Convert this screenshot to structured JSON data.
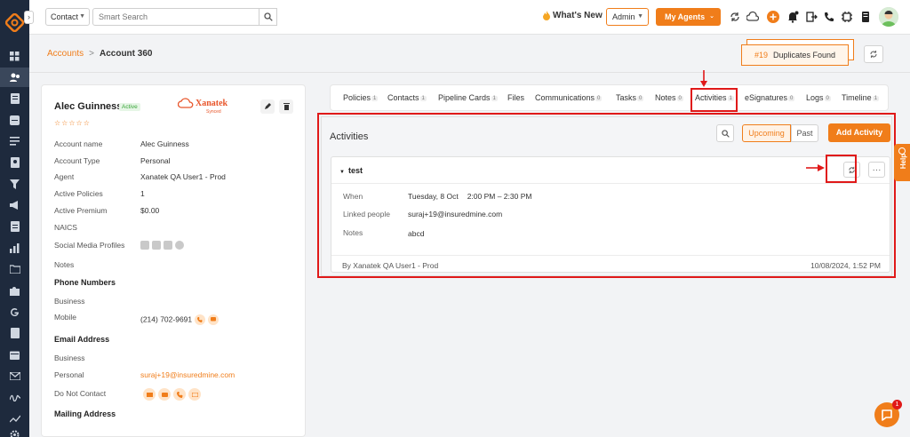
{
  "topbar": {
    "contact_select": "Contact",
    "search_placeholder": "Smart Search",
    "whats_new": "What's New",
    "admin_select": "Admin",
    "my_agents": "My Agents"
  },
  "breadcrumb": {
    "accounts": "Accounts",
    "separator": ">",
    "current": "Account 360"
  },
  "duplicates": {
    "count": "#19",
    "label": "Duplicates Found"
  },
  "account": {
    "name": "Alec Guinness",
    "status": "Active",
    "rating": "☆☆☆☆☆",
    "logo_text": "Xanatek",
    "logo_sub": "Synced",
    "fields": [
      {
        "label": "Account name",
        "value": "Alec Guinness"
      },
      {
        "label": "Account Type",
        "value": "Personal"
      },
      {
        "label": "Agent",
        "value": "Xanatek QA User1 - Prod"
      },
      {
        "label": "Active Policies",
        "value": "1"
      },
      {
        "label": "Active Premium",
        "value": "$0.00"
      },
      {
        "label": "NAICS",
        "value": ""
      },
      {
        "label": "Social Media Profiles",
        "value": ""
      },
      {
        "label": "Notes",
        "value": ""
      }
    ],
    "phone_section": "Phone Numbers",
    "phone_business": "Business",
    "phone_mobile": "Mobile",
    "phone_mobile_value": "(214) 702-9691",
    "email_section": "Email Address",
    "email_business": "Business",
    "email_personal": "Personal",
    "email_personal_value": "suraj+19@insuredmine.com",
    "do_not_contact": "Do Not Contact",
    "mailing_section": "Mailing Address"
  },
  "tabs": [
    {
      "label": "Policies",
      "count": "1"
    },
    {
      "label": "Contacts",
      "count": "1"
    },
    {
      "label": "Pipeline Cards",
      "count": "1"
    },
    {
      "label": "Files",
      "count": ""
    },
    {
      "label": "Communications",
      "count": "0"
    },
    {
      "label": "Tasks",
      "count": "0"
    },
    {
      "label": "Notes",
      "count": "0"
    },
    {
      "label": "Activities",
      "count": "1"
    },
    {
      "label": "eSignatures",
      "count": "0"
    },
    {
      "label": "Logs",
      "count": "0"
    },
    {
      "label": "Timeline",
      "count": "1"
    }
  ],
  "activities": {
    "title": "Activities",
    "upcoming": "Upcoming",
    "past": "Past",
    "add_button": "Add Activity",
    "item": {
      "title": "test",
      "when_label": "When",
      "when_date": "Tuesday, 8 Oct",
      "when_time": "2:00 PM – 2:30 PM",
      "linked_label": "Linked people",
      "linked_value": "suraj+19@insuredmine.com",
      "notes_label": "Notes",
      "notes_value": "abcd",
      "by": "By Xanatek QA User1 - Prod",
      "timestamp": "10/08/2024, 1:52 PM"
    }
  },
  "help": "Help",
  "chat_badge": "1",
  "colors": {
    "accent": "#f07d1a",
    "sidebar": "#1e2a3d",
    "highlight": "#e01919"
  }
}
